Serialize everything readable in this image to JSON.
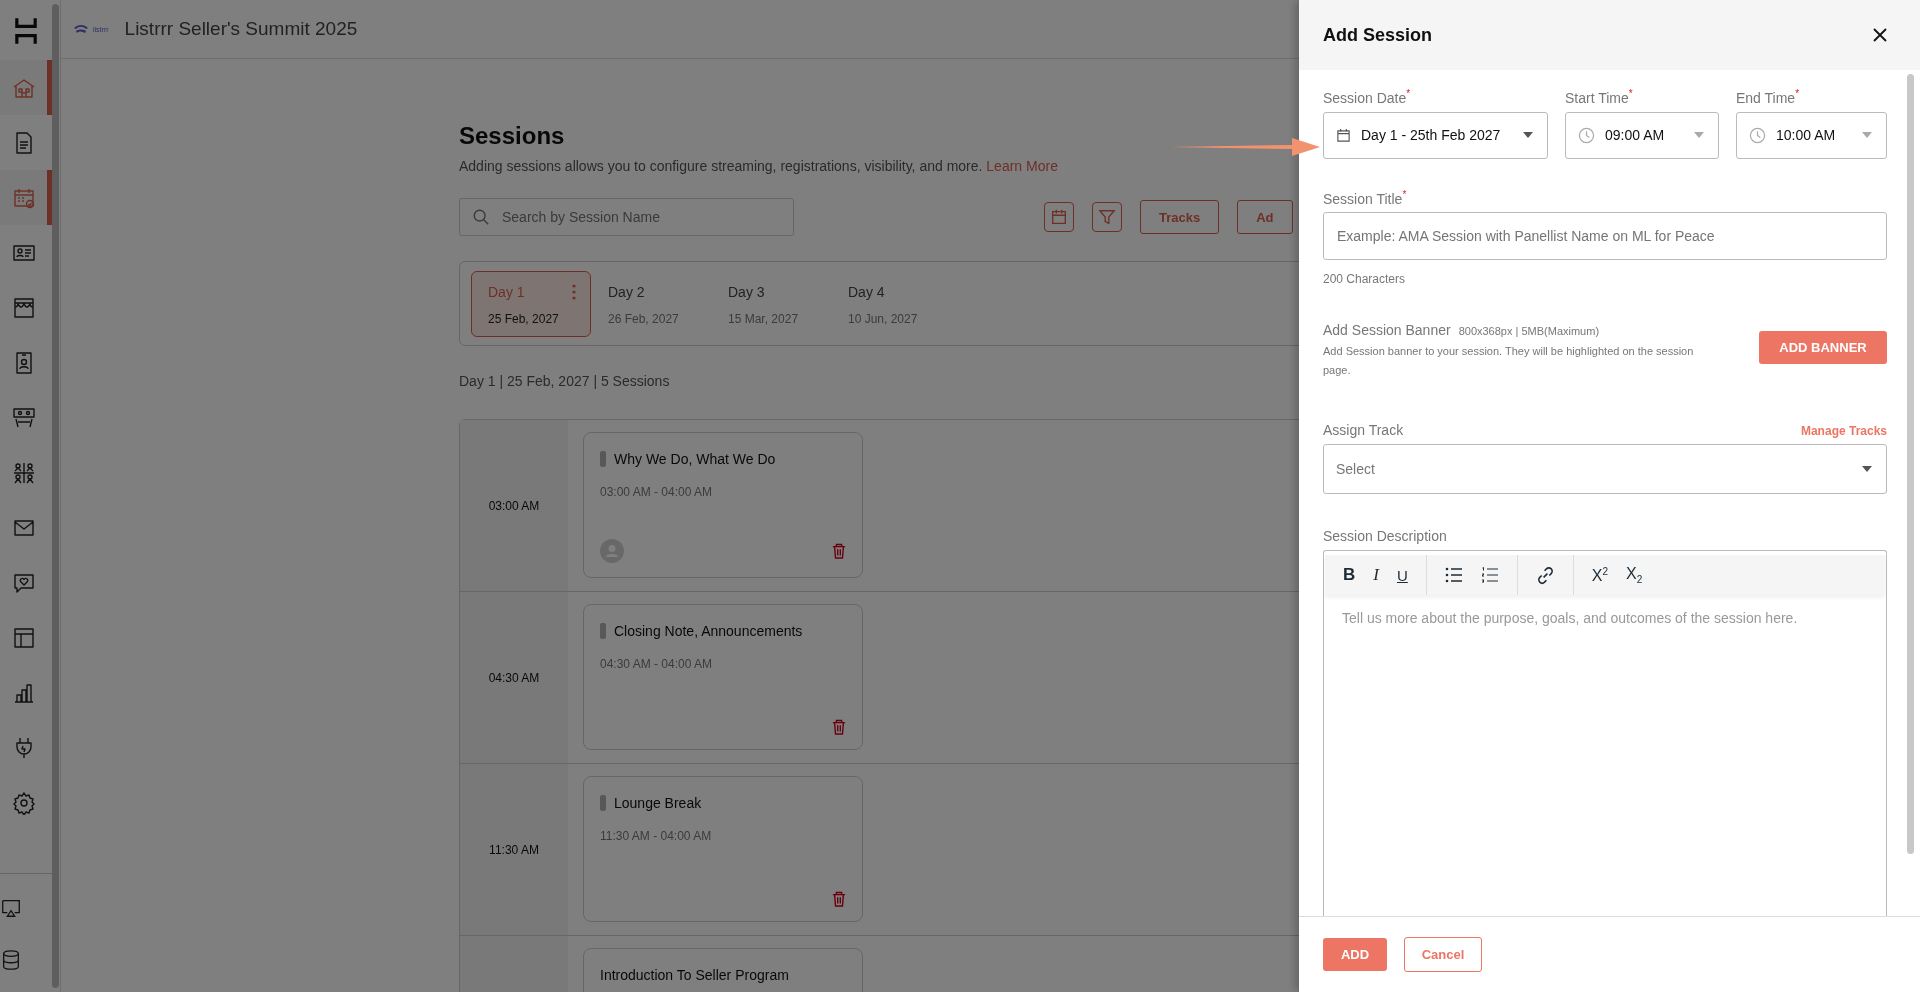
{
  "sidebar": {
    "items": [
      {
        "selected": true
      },
      {
        "selected": false
      },
      {
        "selected": true
      },
      {
        "selected": false
      },
      {
        "selected": false
      },
      {
        "selected": false
      },
      {
        "selected": false
      },
      {
        "selected": false
      },
      {
        "selected": false
      },
      {
        "selected": false
      },
      {
        "selected": false
      },
      {
        "selected": false
      },
      {
        "selected": false
      },
      {
        "selected": false
      }
    ],
    "bottom_items": [
      {
        "selected": false
      },
      {
        "selected": false
      }
    ]
  },
  "header": {
    "logo_text": "listrrr",
    "title": "Listrrr Seller's Summit 2025"
  },
  "page": {
    "title": "Sessions",
    "subtitle": "Adding sessions allows you to configure streaming, registrations, visibility, and more.",
    "learn_more": "Learn More",
    "search": {
      "placeholder": "Search by Session Name"
    },
    "buttons": [
      "Tracks",
      "Ad"
    ],
    "days": [
      {
        "day": "Day 1",
        "date": "25 Feb, 2027",
        "selected": true
      },
      {
        "day": "Day 2",
        "date": "26 Feb, 2027",
        "selected": false
      },
      {
        "day": "Day 3",
        "date": "15 Mar, 2027",
        "selected": false
      },
      {
        "day": "Day 4",
        "date": "10 Jun, 2027",
        "selected": false
      }
    ],
    "summary": "Day 1 | 25 Feb, 2027 | 5 Sessions",
    "sessions": [
      {
        "time": "03:00 AM",
        "title": "Why We Do, What We Do",
        "range": "03:00 AM - 04:00 AM",
        "track_marker": true,
        "host_avatar": true
      },
      {
        "time": "04:30 AM",
        "title": "Closing Note, Announcements",
        "range": "04:30 AM - 04:00 AM",
        "track_marker": true,
        "host_avatar": false
      },
      {
        "time": "11:30 AM",
        "title": "Lounge Break",
        "range": "11:30 AM - 04:00 AM",
        "track_marker": true,
        "host_avatar": false
      },
      {
        "title": "Introduction To Seller Program",
        "track_marker": false,
        "host_avatar": false
      }
    ]
  },
  "drawer": {
    "title": "Add Session",
    "date": {
      "label": "Session Date$^{*}$",
      "value": "Day 1 - 25th Feb 2027"
    },
    "start": {
      "label": "Start Time$^{*}$",
      "value": "09:00 AM"
    },
    "end": {
      "label": "End Time$^{*}$",
      "value": "10:00 AM"
    },
    "session_title": {
      "label": "Session Title$^{*}$",
      "placeholder": "Example: AMA Session with Panellist Name on ML for Peace",
      "helper": "200 Characters"
    },
    "banner": {
      "label": "Add Session Banner",
      "spec": "800x368px | 5MB(Maximum)",
      "description": "Add Session banner to your session. They will be highlighted on the session page.",
      "button": "ADD BANNER"
    },
    "track": {
      "label": "Assign Track",
      "link": "Manage Tracks",
      "placeholder": "Select"
    },
    "description": {
      "label": "Session Description",
      "placeholder": "Tell us more about the purpose, goals, and outcomes of the session here.",
      "toolbar": [
        [
          {
            "kind": "bold",
            "label": "B"
          },
          {
            "kind": "italic",
            "label": "I"
          },
          {
            "kind": "underline",
            "label": "U"
          }
        ],
        [
          {
            "kind": "bullets"
          },
          {
            "kind": "numbers"
          }
        ],
        [
          {
            "kind": "link"
          }
        ],
        [
          {
            "kind": "superscript",
            "label": "X$^{2}$"
          },
          {
            "kind": "subscript",
            "label": "X$_{2}$"
          }
        ]
      ]
    },
    "buttons": {
      "primary": "ADD",
      "secondary": "Cancel"
    }
  }
}
